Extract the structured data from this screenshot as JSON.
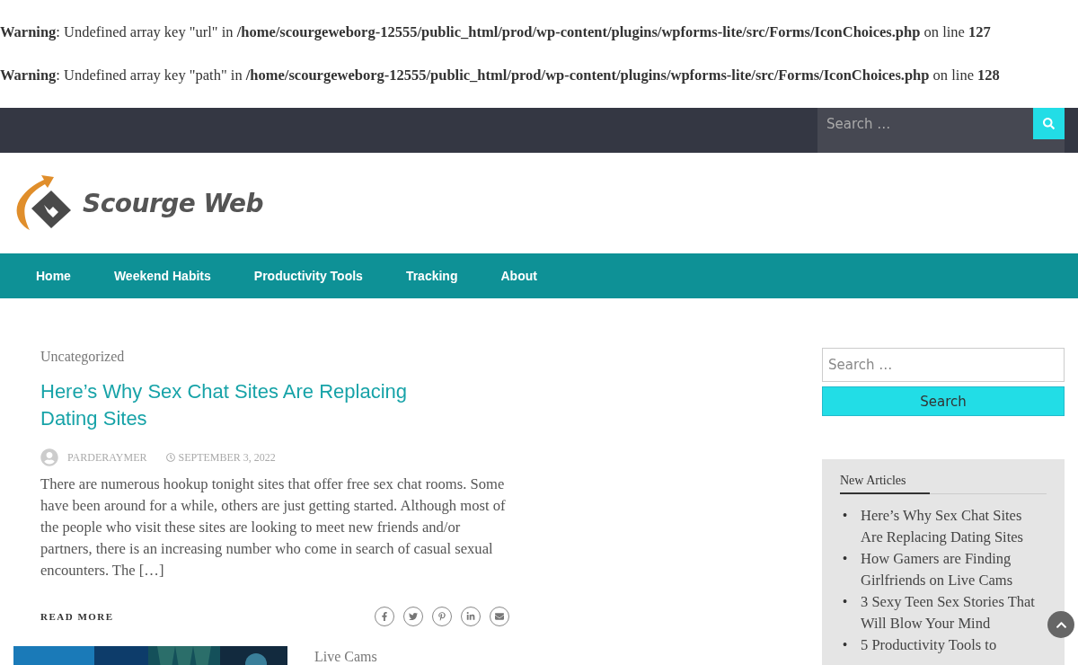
{
  "warnings": [
    {
      "label": "Warning",
      "before": ": Undefined array key \"url\" in ",
      "path": "/home/scourgeweborg-12555/public_html/prod/wp-content/plugins/wpforms-lite/src/Forms/IconChoices.php",
      "middle": " on line ",
      "line": "127"
    },
    {
      "label": "Warning",
      "before": ": Undefined array key \"path\" in ",
      "path": "/home/scourgeweborg-12555/public_html/prod/wp-content/plugins/wpforms-lite/src/Forms/IconChoices.php",
      "middle": " on line ",
      "line": "128"
    }
  ],
  "top_search": {
    "placeholder": "Search …"
  },
  "logo": {
    "text": "Scourge Web"
  },
  "nav": [
    "Home",
    "Weekend Habits",
    "Productivity Tools",
    "Tracking",
    "About"
  ],
  "post": {
    "category": "Uncategorized",
    "title": "Here’s Why Sex Chat Sites Are Replacing Dating Sites",
    "author": "PARDERAYMER",
    "date": "SEPTEMBER 3, 2022",
    "excerpt": "There are numerous hookup tonight sites that offer free sex chat rooms. Some have been around for a while, others are just getting started. Although most of the people who visit these sites are looking to meet new friends and/or partners, there is an increasing number who come in search of casual sexual encounters. The […]",
    "read_more": "READ MORE"
  },
  "next_post": {
    "category": "Live Cams"
  },
  "sidebar": {
    "search": {
      "placeholder": "Search …",
      "button": "Search"
    },
    "widget": {
      "title": "New Articles",
      "items": [
        {
          "bullet": "•",
          "text": "Here’s Why Sex Chat Sites Are Replacing Dating Sites"
        },
        {
          "bullet": "•",
          "text": "How Gamers are Finding Girlfriends on Live Cams"
        },
        {
          "bullet": "•",
          "text": "3 Sexy Teen Sex Stories That Will Blow Your Mind"
        },
        {
          "bullet": "•",
          "text": "5 Productivity Tools to"
        }
      ]
    }
  }
}
